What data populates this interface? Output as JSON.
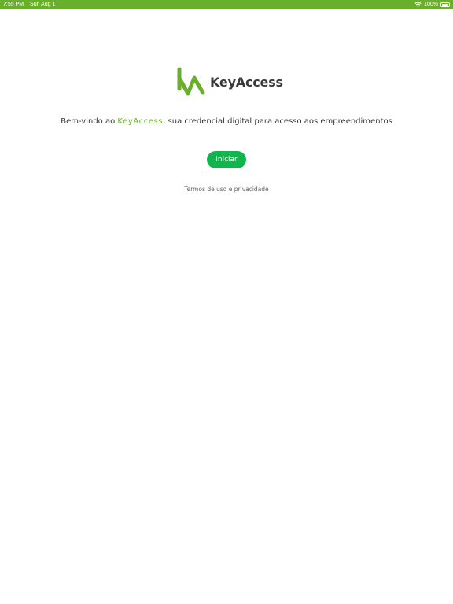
{
  "status_bar": {
    "time": "7:55 PM",
    "date": "Sun Aug 1",
    "battery": "100%",
    "background_color": "#6aaf2a",
    "icons": [
      "wifi-icon",
      "battery-icon"
    ]
  },
  "logo": {
    "text": "KeyAccess",
    "mark_color": "#6aaf2a",
    "text_color": "#3a3a3a"
  },
  "welcome": {
    "prefix": "Bem-vindo ao ",
    "brand": "KeyAccess",
    "suffix": ", sua credencial digital para acesso aos empreendimentos",
    "brand_color": "#6aaf2a"
  },
  "actions": {
    "start_label": "Iniciar",
    "start_color": "#12b54d",
    "terms_label": "Termos de uso e privacidade"
  }
}
